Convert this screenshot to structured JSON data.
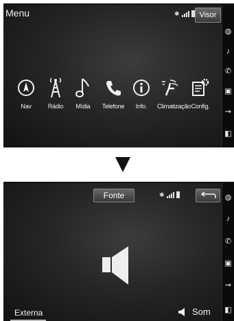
{
  "top_screen": {
    "title": "Menu",
    "visor_label": "Visor",
    "menu_items": [
      {
        "label": "Nav",
        "icon": "compass-icon"
      },
      {
        "label": "Rádio",
        "icon": "radio-tower-icon"
      },
      {
        "label": "Mídia",
        "icon": "music-note-icon"
      },
      {
        "label": "Telefone",
        "icon": "phone-icon"
      },
      {
        "label": "Info.",
        "icon": "info-icon"
      },
      {
        "label": "Climatização",
        "icon": "climate-seat-icon"
      },
      {
        "label": "Config.",
        "icon": "settings-document-icon"
      }
    ]
  },
  "bottom_screen": {
    "source_label": "Fonte",
    "external_label": "Externa",
    "sound_label": "Som"
  },
  "colors": {
    "screen_bg": "#262626",
    "text": "#f2f2f2",
    "button_bg": "#4a4a4a"
  }
}
